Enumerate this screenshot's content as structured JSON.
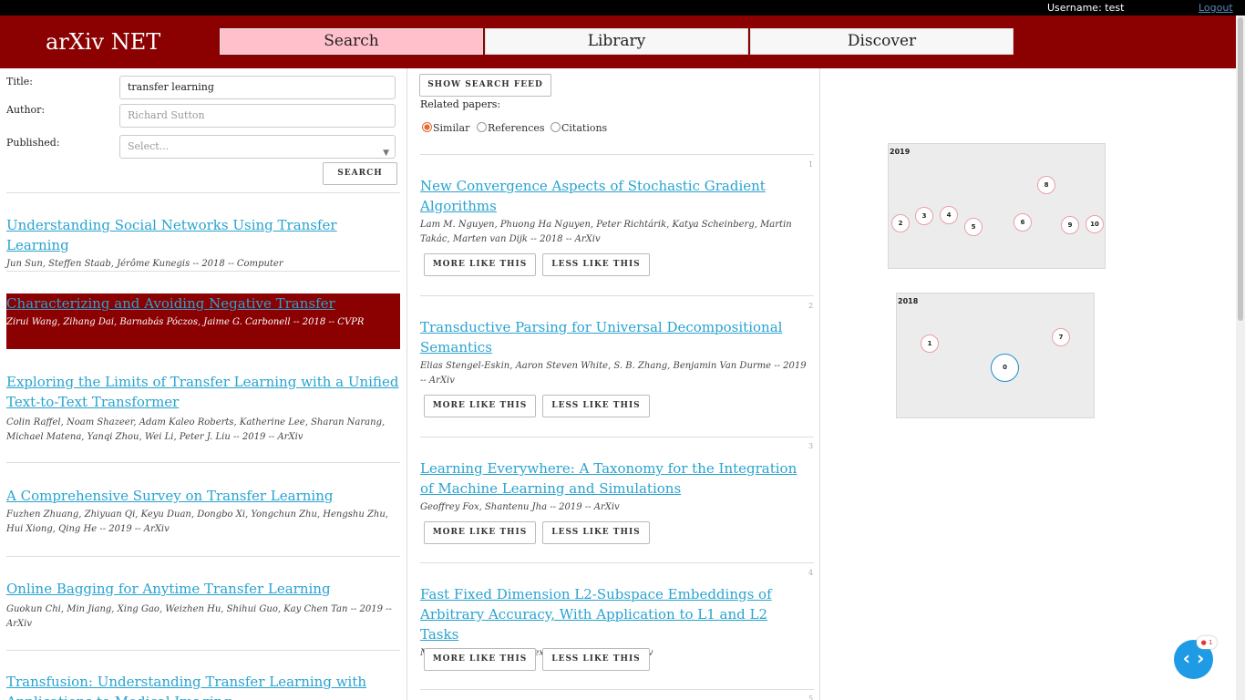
{
  "topbar": {
    "username": "Username: test",
    "logout": "Logout"
  },
  "header": {
    "brand": "arXiv NET",
    "tabs": [
      {
        "label": "Search",
        "active": true
      },
      {
        "label": "Library",
        "active": false
      },
      {
        "label": "Discover",
        "active": false
      }
    ]
  },
  "search_form": {
    "title_label": "Title:",
    "title_value": "transfer learning",
    "author_label": "Author:",
    "author_placeholder": "Richard Sutton",
    "published_label": "Published:",
    "published_placeholder": "Select...",
    "search_button": "Search"
  },
  "search_results": [
    {
      "title": "Understanding Social Networks Using Transfer Learning",
      "meta": "Jun Sun, Steffen Staab, Jérôme Kunegis -- 2018 -- Computer"
    },
    {
      "title": "Characterizing and Avoiding Negative Transfer",
      "meta": "Zirui Wang, Zihang Dai, Barnabás Póczos, Jaime G. Carbonell -- 2018 -- CVPR",
      "selected": true
    },
    {
      "title": "Exploring the Limits of Transfer Learning with a Unified Text-to-Text Transformer",
      "meta": "Colin Raffel, Noam Shazeer, Adam Kaleo Roberts, Katherine Lee, Sharan Narang, Michael Matena, Yanqi Zhou, Wei Li, Peter J. Liu -- 2019 -- ArXiv"
    },
    {
      "title": "A Comprehensive Survey on Transfer Learning",
      "meta": "Fuzhen Zhuang, Zhiyuan Qi, Keyu Duan, Dongbo Xi, Yongchun Zhu, Hengshu Zhu, Hui Xiong, Qing He -- 2019 -- ArXiv"
    },
    {
      "title": "Online Bagging for Anytime Transfer Learning",
      "meta": "Guokun Chi, Min Jiang, Xing Gao, Weizhen Hu, Shihui Guo, Kay Chen Tan -- 2019 -- ArXiv"
    },
    {
      "title": "Transfusion: Understanding Transfer Learning with Applications to Medical Imaging",
      "meta": ""
    }
  ],
  "related": {
    "show_feed_button": "Show search feed",
    "label": "Related papers:",
    "options": [
      "Similar",
      "References",
      "Citations"
    ],
    "selected_option": "Similar",
    "more_button": "More like this",
    "less_button": "Less like this",
    "papers": [
      {
        "num": "1",
        "title": "New Convergence Aspects of Stochastic Gradient Algorithms",
        "meta": "Lam M. Nguyen, Phuong Ha Nguyen, Peter Richtárik, Katya Scheinberg, Martin Takác, Marten van Dijk -- 2018 -- ArXiv"
      },
      {
        "num": "2",
        "title": "Transductive Parsing for Universal Decompositional Semantics",
        "meta": "Elias Stengel-Eskin, Aaron Steven White, S. B. Zhang, Benjamin Van Durme -- 2019 -- ArXiv"
      },
      {
        "num": "3",
        "title": "Learning Everywhere: A Taxonomy for the Integration of Machine Learning and Simulations",
        "meta": "Geoffrey Fox, Shantenu Jha -- 2019 -- ArXiv"
      },
      {
        "num": "4",
        "title": "Fast Fixed Dimension L2-Subspace Embeddings of Arbitrary Accuracy, With Application to L1 and L2 Tasks",
        "meta": "Malik Magdon-Ismail, Alex Gittens -- 2019 -- ArXiv"
      }
    ],
    "next_num": "5"
  },
  "graph": {
    "year_2019": "2019",
    "year_2018": "2018",
    "nodes_2019": [
      "2",
      "3",
      "4",
      "5",
      "6",
      "8",
      "9",
      "10"
    ],
    "nodes_2018": [
      "1",
      "7",
      "0"
    ]
  },
  "fab": {
    "icon": "code-icon",
    "glyph": "‹ ›",
    "badge": "1"
  }
}
